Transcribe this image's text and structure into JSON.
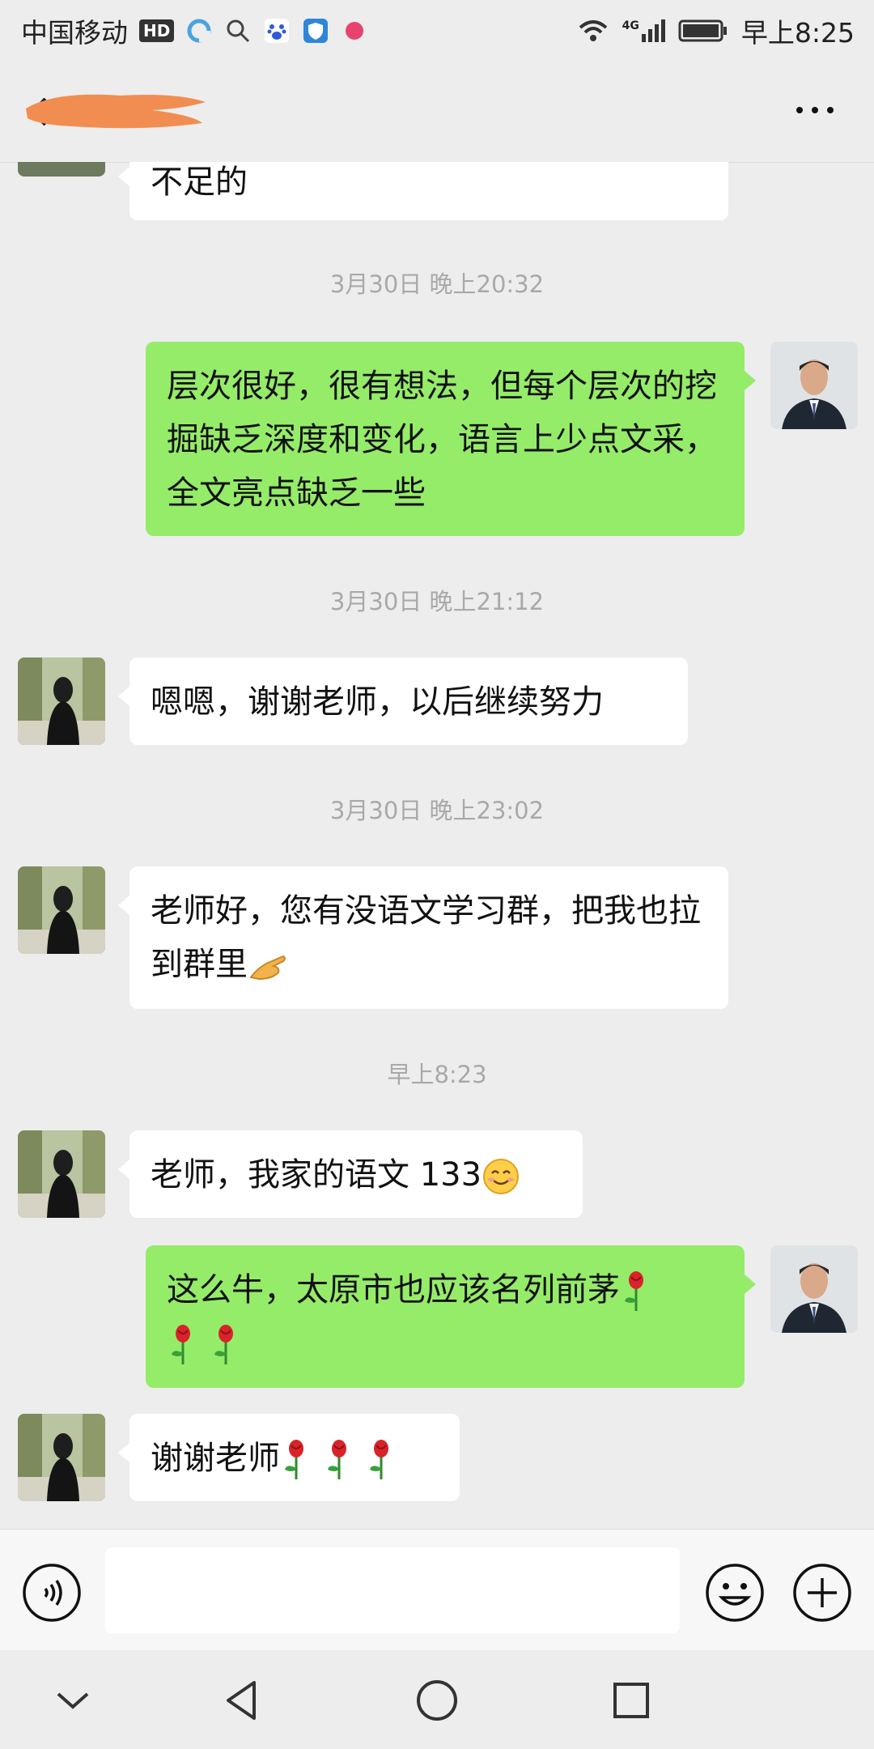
{
  "status_bar": {
    "carrier": "中国移动",
    "hd": "HD",
    "network": "4G",
    "time": "早上8:25"
  },
  "header": {
    "contact_name": ""
  },
  "messages": [
    {
      "side": "left",
      "text": "不足的"
    },
    {
      "type": "timestamp",
      "text": "3月30日 晚上20:32"
    },
    {
      "side": "right",
      "text": "层次很好，很有想法，但每个层次的挖掘缺乏深度和变化，语言上少点文采，全文亮点缺乏一些"
    },
    {
      "type": "timestamp",
      "text": "3月30日 晚上21:12"
    },
    {
      "side": "left",
      "text": "嗯嗯，谢谢老师，以后继续努力"
    },
    {
      "type": "timestamp",
      "text": "3月30日 晚上23:02"
    },
    {
      "side": "left",
      "text": "老师好，您有没语文学习群，把我也拉到群里"
    },
    {
      "type": "timestamp",
      "text": "早上8:23"
    },
    {
      "side": "left",
      "text": "老师，我家的语文 133"
    },
    {
      "side": "right",
      "text": "这么牛，太原市也应该名列前茅"
    },
    {
      "side": "left",
      "text": "谢谢老师"
    }
  ],
  "input": {
    "placeholder": ""
  },
  "colors": {
    "background": "#ededed",
    "sent_bubble": "#95ec69",
    "received_bubble": "#ffffff",
    "timestamp": "#a9a9a9"
  },
  "icons": [
    "back-arrow-icon",
    "more-icon",
    "voice-icon",
    "emoji-icon",
    "plus-icon",
    "nav-down-icon",
    "nav-back-icon",
    "nav-home-icon",
    "nav-recents-icon",
    "rose-emoji",
    "pinch-hand-emoji",
    "smile-emoji"
  ]
}
